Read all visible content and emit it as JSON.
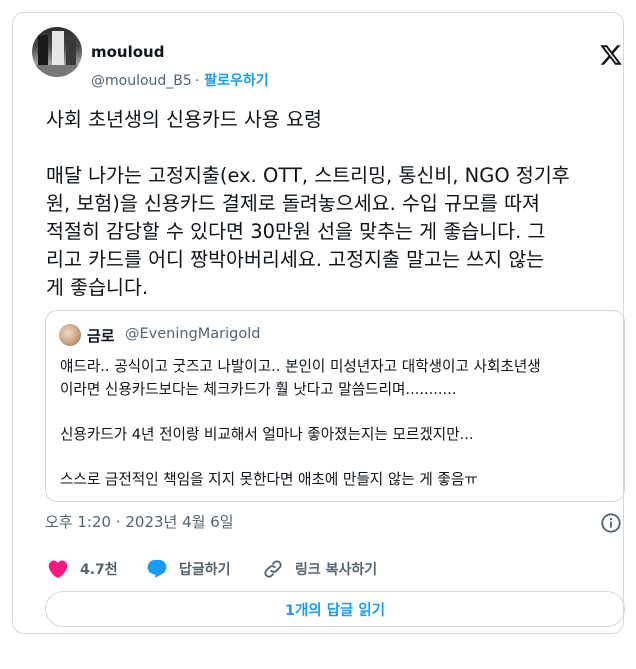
{
  "author": {
    "name": "mouloud",
    "handle": "@mouloud_B5",
    "separator": "·",
    "follow_label": "팔로우하기"
  },
  "tweet": {
    "lines_para1": [
      "사회 초년생의 신용카드 사용 요령"
    ],
    "lines_para2": [
      "매달 나가는 고정지출(ex. OTT, 스트리밍, 통신비, NGO 정기후",
      "원, 보험)을 신용카드 결제로 돌려놓으세요. 수입 규모를 따져",
      "적절히 감당할 수 있다면 30만원 선을 맞추는 게 좋습니다. 그",
      "리고 카드를 어디 짱박아버리세요. 고정지출 말고는 쓰지 않는",
      "게 좋습니다."
    ]
  },
  "quote": {
    "name": "금로",
    "handle": "@EveningMarigold",
    "lines": [
      "얘드라.. 공식이고 굿즈고 나발이고.. 본인이 미성년자고 대학생이고 사회초년생",
      "이라면 신용카드보다는 체크카드가 훨 낫다고 말씀드리며...........",
      "",
      "신용카드가 4년 전이랑 비교해서 얼마나 좋아졌는지는 모르겠지만...",
      "",
      "스스로 금전적인 책임을 지지 못한다면 애초에 만들지 않는 게 좋음ㅠ"
    ]
  },
  "timestamp": "오후 1:20 · 2023년 4월 6일",
  "actions": {
    "like_count": "4.7천",
    "reply_label": "답글하기",
    "copy_link_label": "링크 복사하기"
  },
  "read_replies_label": "1개의 답글 읽기",
  "icons": {
    "logo": "x-logo-icon",
    "info": "info-icon",
    "like": "heart-icon",
    "reply": "reply-bubble-icon",
    "link": "link-icon"
  },
  "colors": {
    "accent": "#1d9bf0",
    "like": "#f91880",
    "muted_text": "#536471",
    "border": "#cfd9de"
  }
}
